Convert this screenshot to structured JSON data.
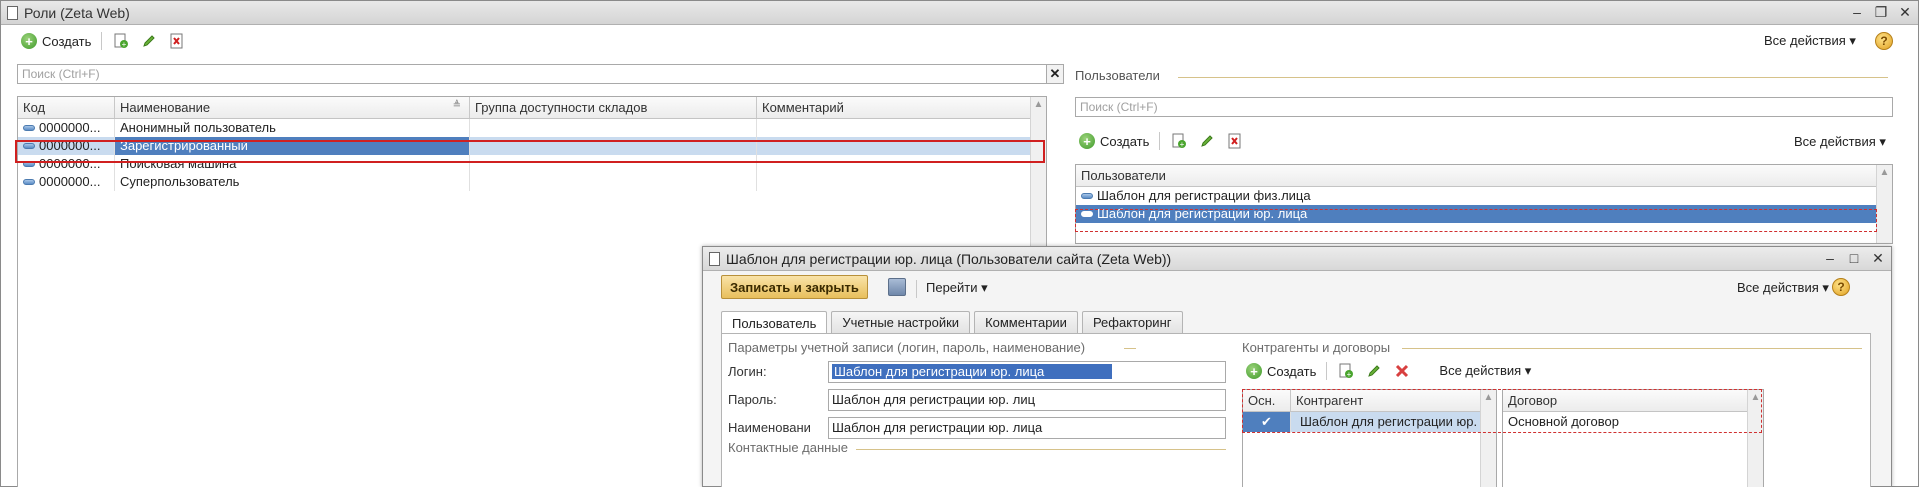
{
  "main_window": {
    "title": "Роли (Zeta Web)",
    "toolbar": {
      "create_label": "Создать",
      "all_actions": "Все действия"
    },
    "search": {
      "placeholder": "Поиск (Ctrl+F)"
    },
    "table": {
      "columns": [
        "Код",
        "Наименование",
        "Группа доступности складов",
        "Комментарий"
      ],
      "rows": [
        {
          "code": "0000000...",
          "name": "Анонимный пользователь",
          "group": "",
          "comment": ""
        },
        {
          "code": "0000000...",
          "name": "Зарегистрированный",
          "group": "",
          "comment": "",
          "selected": true
        },
        {
          "code": "0000000...",
          "name": "Поисковая машина",
          "group": "",
          "comment": ""
        },
        {
          "code": "0000000...",
          "name": "Суперпользователь",
          "group": "",
          "comment": ""
        }
      ]
    }
  },
  "users_panel": {
    "title": "Пользователи",
    "search": {
      "placeholder": "Поиск (Ctrl+F)"
    },
    "toolbar": {
      "create_label": "Создать",
      "all_actions": "Все действия"
    },
    "table": {
      "column": "Пользователи",
      "rows": [
        {
          "name": "Шаблон для регистрации физ.лица"
        },
        {
          "name": "Шаблон для регистрации юр. лица",
          "selected": true
        }
      ]
    }
  },
  "child_window": {
    "title": "Шаблон для регистрации юр. лица (Пользователи сайта (Zeta Web))",
    "save_close_label": "Записать и закрыть",
    "goto_label": "Перейти",
    "all_actions": "Все действия",
    "tabs": [
      "Пользователь",
      "Учетные настройки",
      "Комментарии",
      "Рефакторинг"
    ],
    "account_section": {
      "title": "Параметры учетной записи (логин, пароль, наименование)",
      "login_label": "Логин:",
      "login_value": "Шаблон для регистрации юр. лица",
      "password_label": "Пароль:",
      "password_value": "Шаблон для регистрации юр. лиц",
      "name_label": "Наименовани",
      "name_value": "Шаблон для регистрации юр. лица"
    },
    "contact_section": {
      "title": "Контактные данные"
    },
    "contractors_section": {
      "title": "Контрагенты и договоры",
      "create_label": "Создать",
      "all_actions": "Все действия",
      "columns": [
        "Осн.",
        "Контрагент"
      ],
      "rows": [
        {
          "main": "✔",
          "contractor": "Шаблон для регистрации юр. ..."
        }
      ],
      "contract_column": "Договор",
      "contract_rows": [
        {
          "contract": "Основной договор"
        }
      ]
    }
  },
  "colors": {
    "accent": "#4f7fbe",
    "selection": "#c9dbef",
    "highlight_red": "#d02020"
  }
}
